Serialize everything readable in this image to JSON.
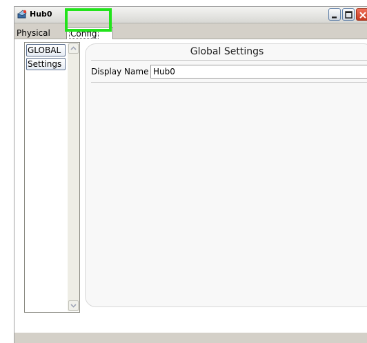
{
  "window": {
    "title": "Hub0",
    "icon": "hub-device-icon"
  },
  "tabs": [
    {
      "label": "Physical",
      "active": false
    },
    {
      "label": "Config",
      "active": true,
      "highlighted": true
    }
  ],
  "sidebar": {
    "items": [
      {
        "label": "GLOBAL"
      },
      {
        "label": "Settings"
      }
    ]
  },
  "settings_panel": {
    "title": "Global Settings",
    "display_name_label": "Display Name",
    "display_name_value": "Hub0"
  },
  "colors": {
    "highlight": "#22e31b",
    "close_button": "#d2462c"
  }
}
